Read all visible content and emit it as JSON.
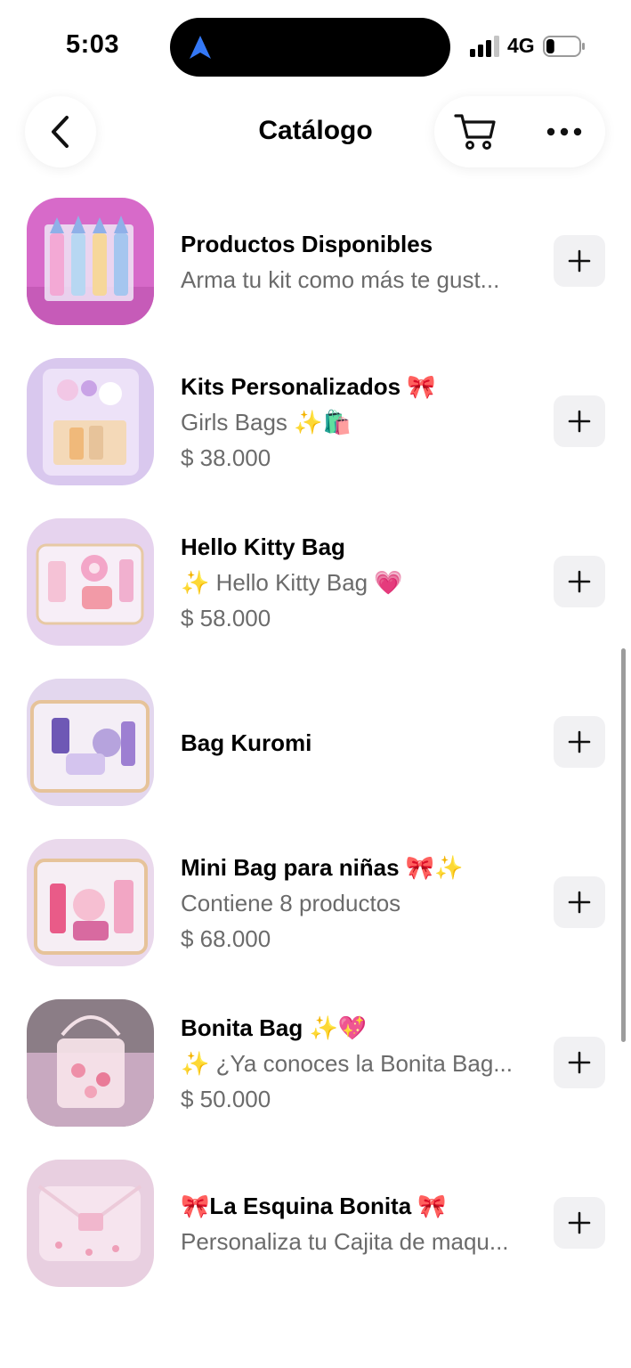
{
  "status": {
    "time": "5:03",
    "network": "4G",
    "battery_level": 0.25,
    "accent_color": "#3478f6"
  },
  "header": {
    "title": "Catálogo",
    "back_icon": "chevron-left-icon",
    "cart_icon": "cart-icon",
    "more_icon": "ellipsis-icon"
  },
  "products": [
    {
      "name": "Productos Disponibles",
      "desc": "Arma tu kit como más te gust...",
      "price": ""
    },
    {
      "name": "Kits Personalizados 🎀",
      "desc": "Girls Bags ✨🛍️",
      "price": "$ 38.000"
    },
    {
      "name": "Hello Kitty Bag",
      "desc": "✨ Hello Kitty Bag 💗",
      "price": "$ 58.000"
    },
    {
      "name": "Bag Kuromi",
      "desc": "",
      "price": ""
    },
    {
      "name": "Mini Bag para niñas 🎀✨",
      "desc": "Contiene 8 productos",
      "price": "$ 68.000"
    },
    {
      "name": "Bonita Bag ✨💖",
      "desc": "✨ ¿Ya conoces la Bonita Bag...",
      "price": "$ 50.000"
    },
    {
      "name": "🎀La Esquina Bonita 🎀",
      "desc": "Personaliza tu Cajita de maqu...",
      "price": ""
    }
  ]
}
